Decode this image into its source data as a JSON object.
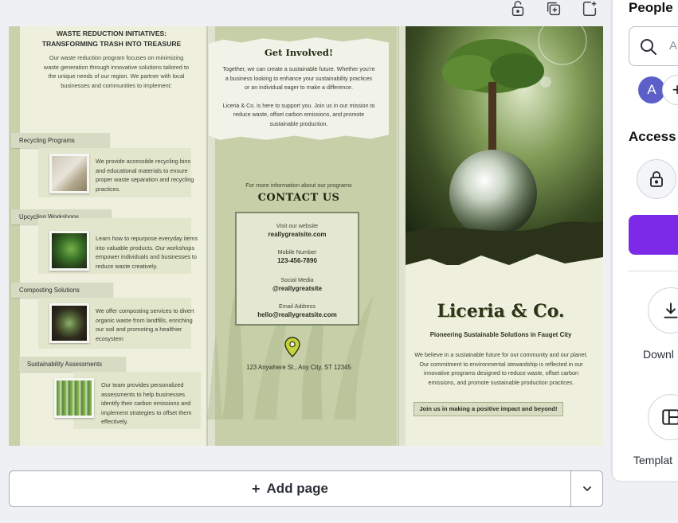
{
  "toolbar": {
    "icons": [
      "lock-open-icon",
      "duplicate-page-icon",
      "add-page-icon"
    ]
  },
  "brochure": {
    "left": {
      "heading_line1": "WASTE REDUCTION INITIATIVES:",
      "heading_line2": "TRANSFORMING TRASH INTO TREASURE",
      "intro": "Our waste reduction program focuses on minimizing waste generation through innovative solutions tailored to the unique needs of our region. We partner with local businesses and communities to implement:",
      "items": [
        {
          "title": "Recycling Programs",
          "text": "We provide accessible recycling bins and educational materials to ensure proper waste separation and recycling practices."
        },
        {
          "title": "Upcycling Workshops",
          "text": "Learn how to repurpose everyday items into valuable products. Our workshops empower individuals and businesses to reduce waste creatively."
        },
        {
          "title": "Composting Solutions",
          "text": "We offer composting services to divert organic waste from landfills, enriching our soil and promoting a healthier ecosystem"
        },
        {
          "title": "Sustainability Assessments",
          "text": "Our team provides personalized assessments to help businesses identify their carbon emissions and implement strategies to offset them effectively."
        }
      ]
    },
    "middle": {
      "get_involved_title": "Get Involved!",
      "get_involved_text1": "Together, we can create a sustainable future. Whether you're a business looking to enhance your sustainability practices or an individual eager to make a difference.",
      "get_involved_text2": "Liceria & Co. is here to support you. Join us in our mission to reduce waste, offset carbon emissions, and promote sustainable production.",
      "more_info": "For more information about our programs",
      "contact_title": "CONTACT US",
      "website_label": "Visit our website",
      "website_value": "reallygreatsite.com",
      "phone_label": "Mobile Number",
      "phone_value": "123-456-7890",
      "social_label": "Social Media",
      "social_value": "@reallygreatsite",
      "email_label": "Email Address",
      "email_value": "hello@reallygreatsite.com",
      "address": "123 Anywhere St., Any City, ST 12345"
    },
    "right": {
      "brand": "Liceria & Co.",
      "tagline": "Pioneering Sustainable Solutions in Fauget City",
      "text": "We believe in a sustainable future for our community and our planet. Our commitment to environmental stewardship is reflected in our innovative programs designed to reduce waste, offset carbon emissions, and promote sustainable production practices.",
      "join": "Join us in making a positive impact and beyond!"
    }
  },
  "bottom": {
    "add_page_label": "Add page"
  },
  "share_panel": {
    "people_heading": "People",
    "search_placeholder": "A",
    "avatar_initial": "A",
    "access_heading": "Access",
    "download_label": "Downl",
    "template_label": "Templat"
  },
  "colors": {
    "accent_purple": "#7d2ae8",
    "avatar": "#5b5fc7",
    "brochure_green": "#c6cfa8"
  }
}
